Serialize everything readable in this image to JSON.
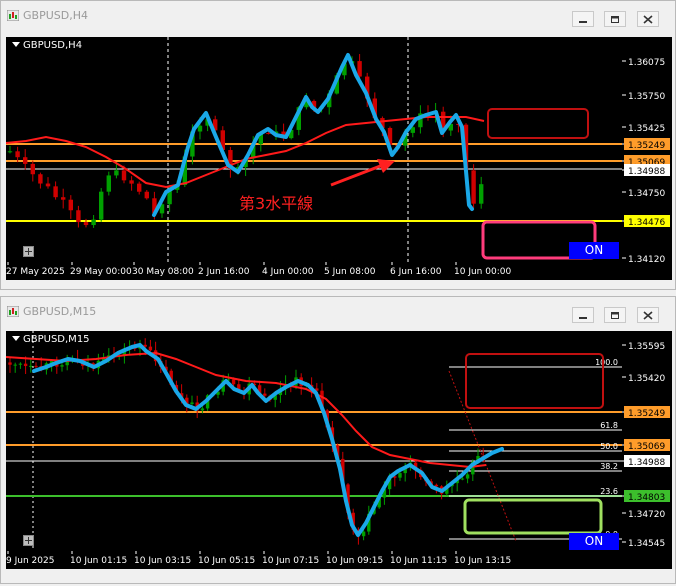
{
  "windows": [
    {
      "title": "GBPUSD,H4",
      "symbol_label": "GBPUSD,H4",
      "on_label": "ON",
      "annotation": "第3水平線",
      "price_labels": [
        "1.36075",
        "1.35750",
        "1.35425",
        "1.35249",
        "1.35069",
        "1.34988",
        "1.34750",
        "1.34476",
        "1.34120"
      ],
      "time_labels": [
        "27 May 2025",
        "29 May 00:00",
        "30 May 08:00",
        "2 Jun 16:00",
        "4 Jun 00:00",
        "5 Jun 08:00",
        "6 Jun 16:00",
        "10 Jun 00:00"
      ]
    },
    {
      "title": "GBPUSD,M15",
      "symbol_label": "GBPUSD,M15",
      "on_label": "ON",
      "fib_levels": [
        "100.0",
        "61.8",
        "50.0",
        "38.2",
        "23.6",
        "0.0"
      ],
      "price_labels": [
        "1.35595",
        "1.35420",
        "1.35249",
        "1.35069",
        "1.34988",
        "1.34803",
        "1.34720",
        "1.34545"
      ],
      "time_labels": [
        "9 Jun 2025",
        "10 Jun 01:15",
        "10 Jun 03:15",
        "10 Jun 05:15",
        "10 Jun 07:15",
        "10 Jun 09:15",
        "10 Jun 11:15",
        "10 Jun 13:15"
      ]
    }
  ],
  "colors": {
    "bull": "#00a000",
    "bear": "#d00000",
    "ma": "#ff1a1a",
    "trace": "#1aa8e8",
    "orange": "#ff9c2a",
    "yellow": "#ffff00",
    "green_line": "#3cbf2c",
    "white_line": "#ffffff",
    "box_red": "#c01010",
    "box_pink": "#ff3c7c",
    "box_green": "#a0e060",
    "on_button": "#0000ff"
  },
  "icons": [
    "app-icon",
    "minimize-icon",
    "restore-icon",
    "close-icon",
    "dropdown-triangle-icon",
    "plus-icon"
  ]
}
